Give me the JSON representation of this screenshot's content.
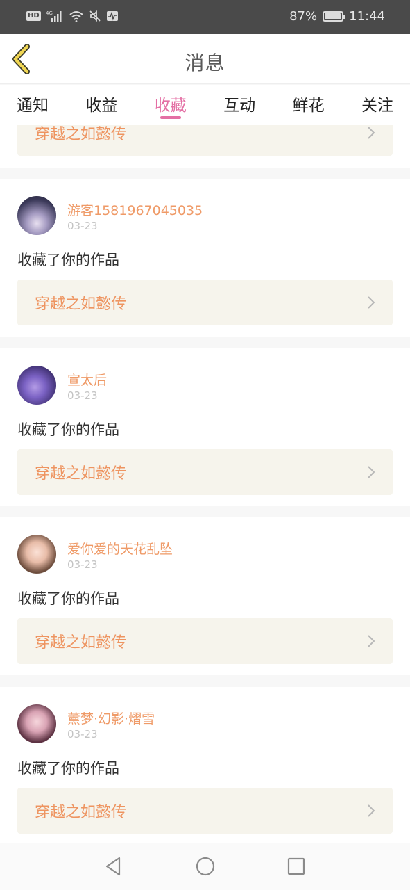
{
  "status_bar": {
    "hd": "HD",
    "network": "4G",
    "battery": "87%",
    "battery_fraction": 0.87,
    "time": "11:44",
    "icons": [
      "signal-icon",
      "wifi-icon",
      "mute-icon",
      "activity-icon"
    ]
  },
  "header": {
    "title": "消息",
    "back_icon": "chevron-left-icon"
  },
  "tabs": [
    {
      "label": "通知",
      "active": false
    },
    {
      "label": "收益",
      "active": false
    },
    {
      "label": "收藏",
      "active": true
    },
    {
      "label": "互动",
      "active": false
    },
    {
      "label": "鲜花",
      "active": false
    },
    {
      "label": "关注",
      "active": false
    }
  ],
  "colors": {
    "accent": "#e46fa4",
    "username": "#ef9a67",
    "work_title": "#ee9460",
    "work_bg": "#f6f4ec"
  },
  "partial_card": {
    "work_title": "穿越之如懿传"
  },
  "messages": [
    {
      "user": "游客1581967045035",
      "date": "03-23",
      "text": "收藏了你的作品",
      "work_title": "穿越之如懿传"
    },
    {
      "user": "宣太后",
      "date": "03-23",
      "text": "收藏了你的作品",
      "work_title": "穿越之如懿传"
    },
    {
      "user": "爱你爱的天花乱坠",
      "date": "03-23",
      "text": "收藏了你的作品",
      "work_title": "穿越之如懿传"
    },
    {
      "user": "薰梦·幻影·熠雪",
      "date": "03-23",
      "text": "收藏了你的作品",
      "work_title": "穿越之如懿传"
    }
  ],
  "nav_bar": {
    "icons": [
      "back-triangle-icon",
      "home-circle-icon",
      "recents-square-icon"
    ]
  }
}
